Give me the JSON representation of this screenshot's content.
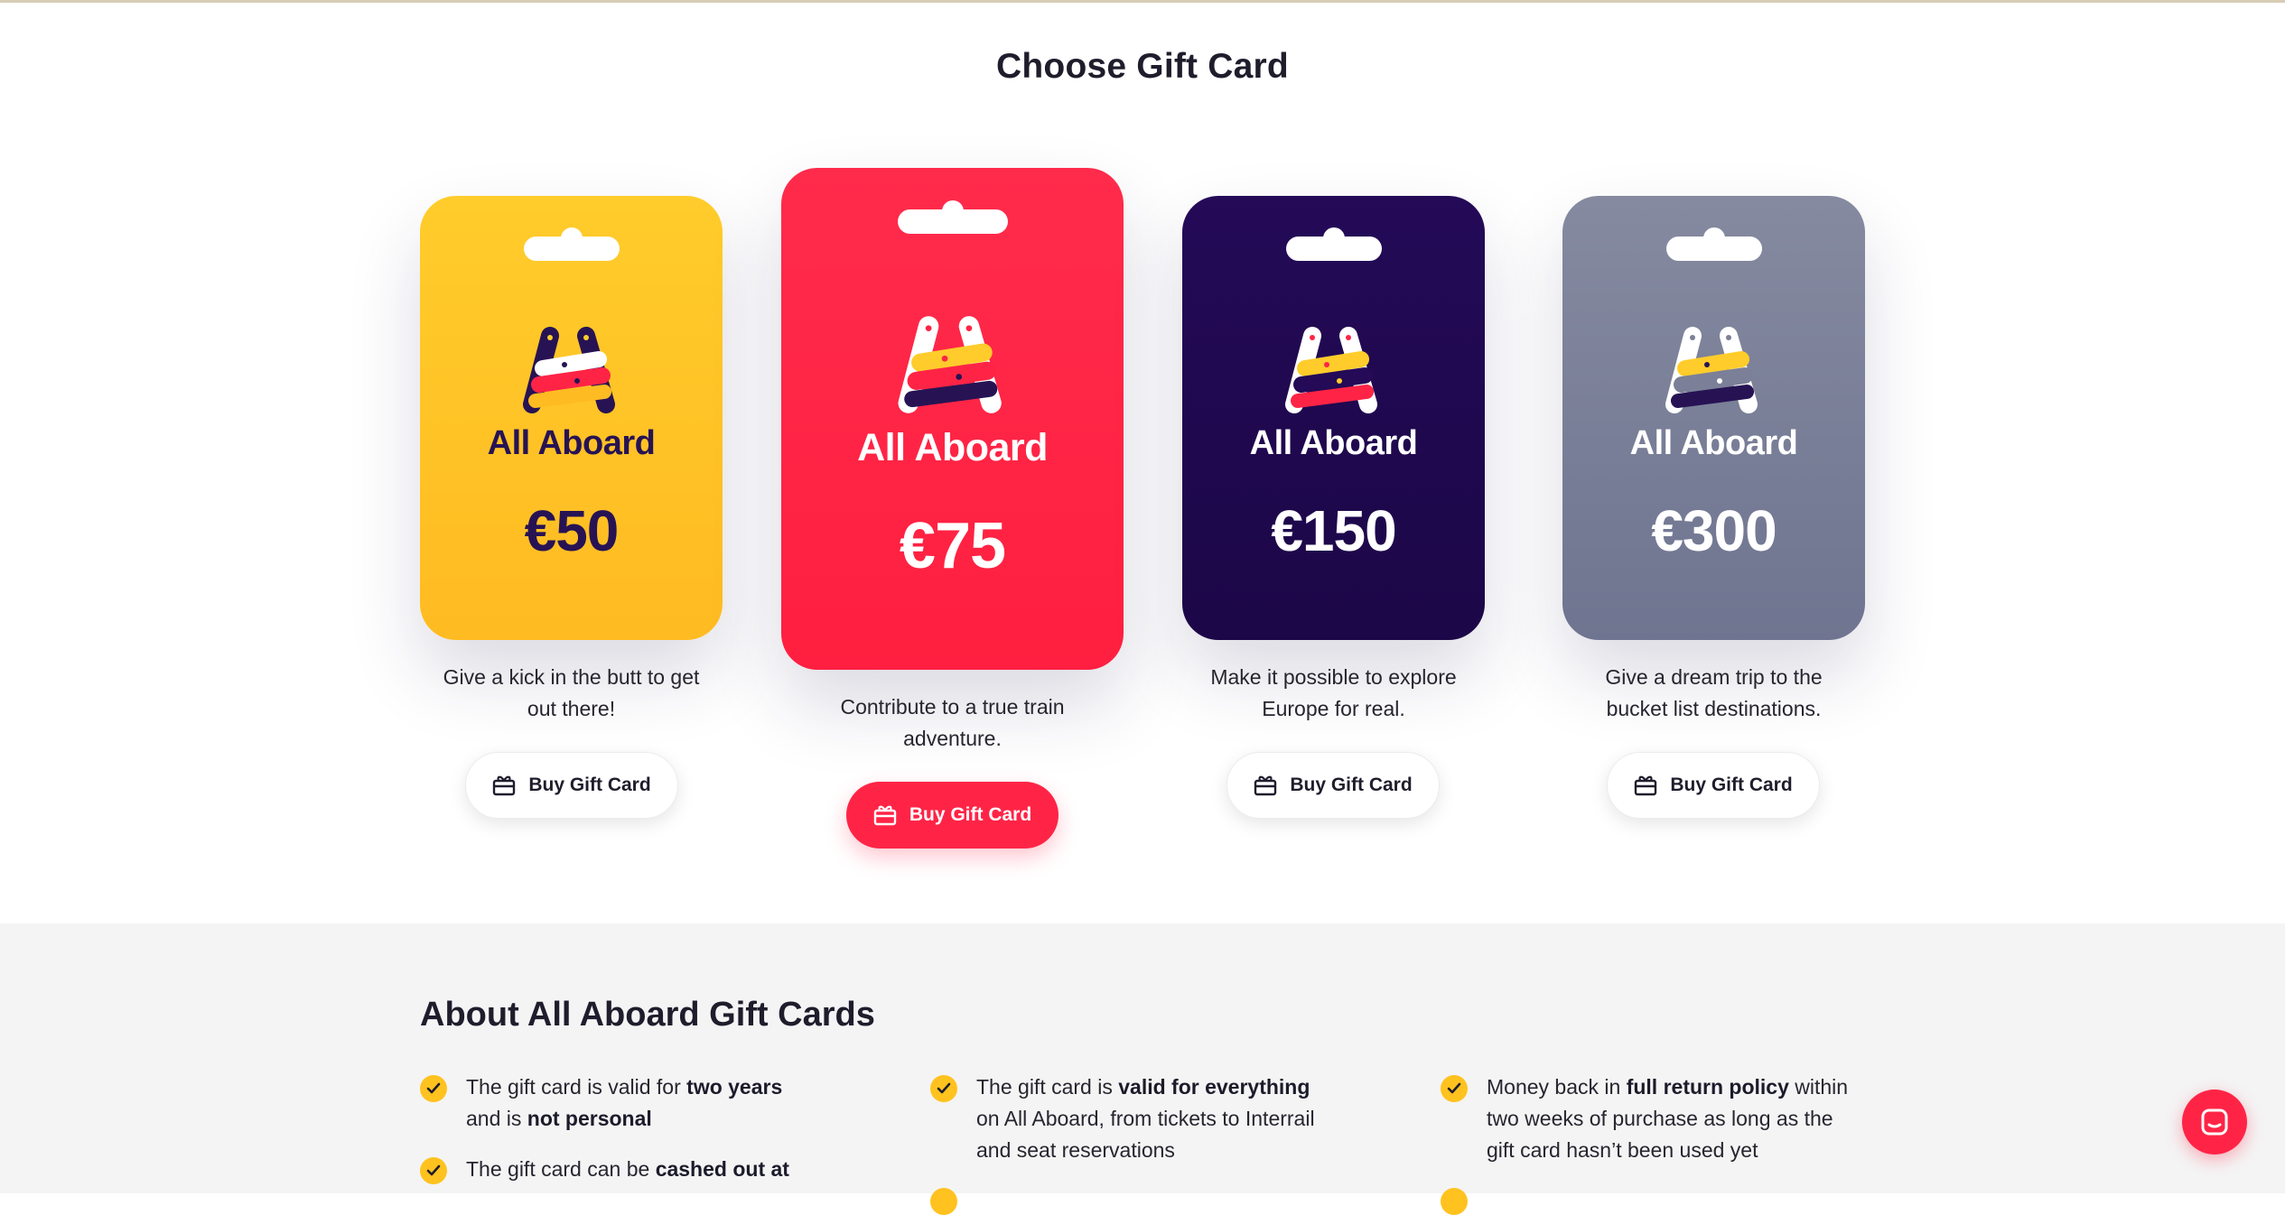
{
  "page": {
    "title": "Choose Gift Card"
  },
  "cards": [
    {
      "brand": "All Aboard",
      "amount": "€50",
      "description_line1": "Give a kick in the butt to get",
      "description_line2": "out there!",
      "button_label": "Buy Gift Card",
      "color_top": "#ffcc2b",
      "color_bottom": "#ffbb22",
      "text_color": "#271354",
      "featured": false
    },
    {
      "brand": "All Aboard",
      "amount": "€75",
      "description_line1": "Contribute to a true train",
      "description_line2": "adventure.",
      "button_label": "Buy Gift Card",
      "color_top": "#ff2b4b",
      "color_bottom": "#ff1f40",
      "text_color": "#ffffff",
      "featured": true
    },
    {
      "brand": "All Aboard",
      "amount": "€150",
      "description_line1": "Make it possible to explore",
      "description_line2": "Europe for real.",
      "button_label": "Buy Gift Card",
      "color_top": "#240a57",
      "color_bottom": "#1c0748",
      "text_color": "#ffffff",
      "featured": false
    },
    {
      "brand": "All Aboard",
      "amount": "€300",
      "description_line1": "Give a dream trip to the",
      "description_line2": "bucket list destinations.",
      "button_label": "Buy Gift Card",
      "color_top": "#858aa0",
      "color_bottom": "#6f7590",
      "text_color": "#ffffff",
      "featured": false
    }
  ],
  "about": {
    "title": "About All Aboard Gift Cards",
    "features": [
      {
        "pre": "The gift card is valid for ",
        "bold1": "two years",
        "mid": "and is ",
        "bold2": "not personal",
        "post": ""
      },
      {
        "pre": "The gift card can be ",
        "bold1": "cashed out at",
        "mid": "",
        "bold2": "",
        "post": ""
      },
      {
        "pre": "The gift card is ",
        "bold1": "valid for everything",
        "mid": "on All Aboard, from tickets to Interrail",
        "bold2": "",
        "post": "and seat reservations"
      },
      {
        "pre": "Money back in ",
        "bold1": "full return policy",
        "mid": " within",
        "bold2": "",
        "line2": "two weeks of purchase as long as the",
        "line3": "gift card hasn’t been used yet"
      }
    ]
  },
  "colors": {
    "accent": "#ff2446",
    "check": "#ffc21f",
    "dark": "#1f1d2c"
  },
  "icons": {
    "button": "gift-icon",
    "check": "check-icon",
    "chat": "chat-icon"
  }
}
